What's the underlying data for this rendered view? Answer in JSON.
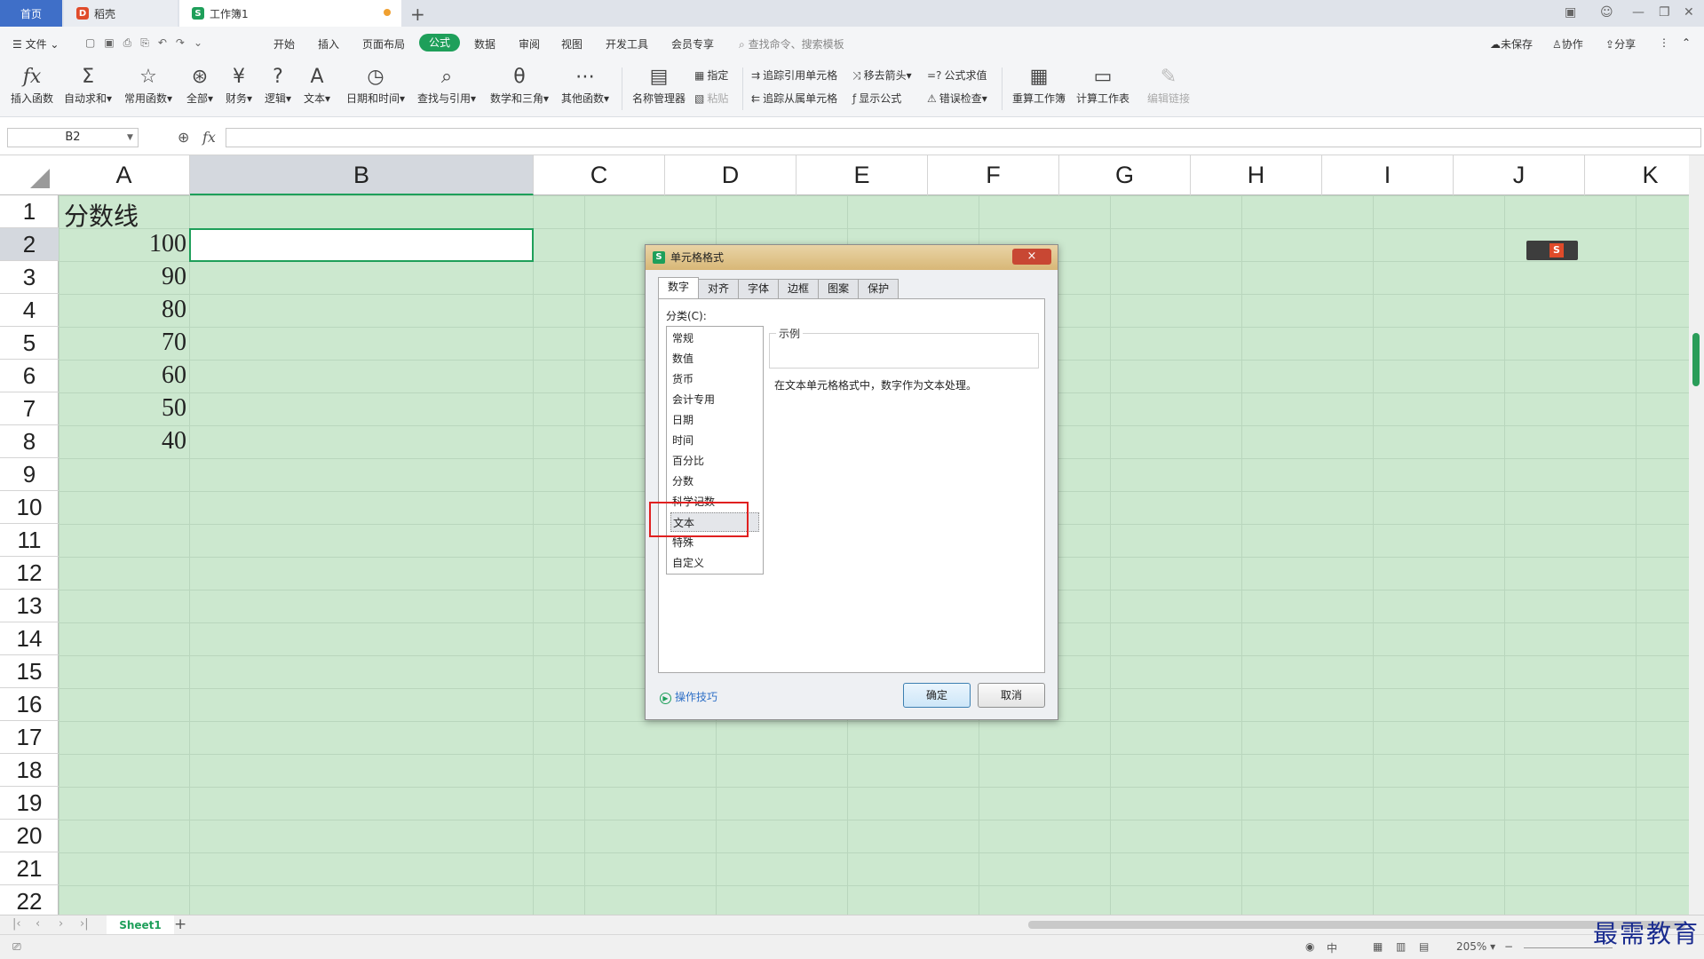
{
  "titlebar": {
    "tabs": [
      "首页",
      "稻壳",
      "工作簿1"
    ],
    "add_tab": "+"
  },
  "menu": {
    "file": "文件",
    "items": [
      "开始",
      "插入",
      "页面布局",
      "公式",
      "数据",
      "审阅",
      "视图",
      "开发工具",
      "会员专享"
    ],
    "active": "公式",
    "search_placeholder": "查找命令、搜索模板",
    "right": [
      "未保存",
      "协作",
      "分享"
    ]
  },
  "ribbon": {
    "big_buttons": [
      "插入函数",
      "自动求和",
      "常用函数",
      "全部",
      "财务",
      "逻辑",
      "文本",
      "日期和时间",
      "查找与引用",
      "数学和三角",
      "其他函数",
      "名称管理器"
    ],
    "small_buttons": [
      "指定",
      "粘贴",
      "追踪引用单元格",
      "追踪从属单元格",
      "移去箭头",
      "显示公式",
      "公式求值",
      "错误检查"
    ],
    "calc_buttons": [
      "重算工作簿",
      "计算工作表",
      "编辑链接"
    ]
  },
  "formula_bar": {
    "name_box": "B2",
    "fx": "fx",
    "value": ""
  },
  "grid": {
    "columns": [
      "A",
      "B",
      "C",
      "D",
      "E",
      "F",
      "G",
      "H",
      "I",
      "J",
      "K"
    ],
    "rows": [
      "1",
      "2",
      "3",
      "4",
      "5",
      "6",
      "7",
      "8",
      "9",
      "10",
      "11",
      "12",
      "13",
      "14",
      "15",
      "16",
      "17",
      "18",
      "19",
      "20",
      "21",
      "22"
    ],
    "selected_column": "B",
    "selected_row": "2",
    "a1": "分数线",
    "a_values": [
      "100",
      "90",
      "80",
      "70",
      "60",
      "50",
      "40"
    ]
  },
  "dialog": {
    "title": "单元格格式",
    "close": "×",
    "tabs": [
      "数字",
      "对齐",
      "字体",
      "边框",
      "图案",
      "保护"
    ],
    "active_tab": "数字",
    "category_label": "分类(C):",
    "categories": [
      "常规",
      "数值",
      "货币",
      "会计专用",
      "日期",
      "时间",
      "百分比",
      "分数",
      "科学记数",
      "文本",
      "特殊",
      "自定义"
    ],
    "selected_category": "文本",
    "example_label": "示例",
    "description": "在文本单元格格式中，数字作为文本处理。",
    "tips": "操作技巧",
    "ok": "确定",
    "cancel": "取消"
  },
  "sheets": {
    "active": "Sheet1",
    "add": "+"
  },
  "status": {
    "zoom": "205%"
  },
  "watermark": "最需教育",
  "colors": {
    "accent": "#1e9f5a",
    "cell_bg": "#cce8cf",
    "highlight": "#e02020"
  }
}
